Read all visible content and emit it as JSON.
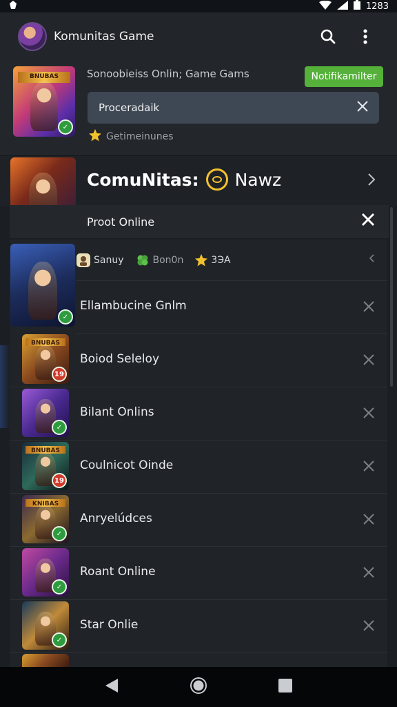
{
  "status_bar": {
    "time": "1283"
  },
  "app_bar": {
    "title": "Komunitas Game",
    "icons": [
      "search-icon",
      "more-vert-icon"
    ]
  },
  "header_card": {
    "subtitle": "Sonoobieiss Onlin; Game Gams",
    "notify_label": "Notifikamilter",
    "search_value": "Proceradaik",
    "rating_text": "Getimeinunes",
    "art_banner": "BNUBAS"
  },
  "featured": {
    "title": "ComuNitas:",
    "news_label": "Nawz",
    "dismiss_label": "Proot Online"
  },
  "meta": {
    "chips": [
      {
        "icon": "user-icon",
        "label": "Sanuy"
      },
      {
        "icon": "clover-icon",
        "label": "Bon0n"
      },
      {
        "icon": "star-icon",
        "label": "3ЭA"
      }
    ]
  },
  "list": {
    "items": [
      {
        "label": "Ellambucine Gnlm",
        "badge": ""
      },
      {
        "label": "Boiod Seleloy",
        "badge": "19",
        "banner": "BNUBAS"
      },
      {
        "label": "Bilant Onlins",
        "badge": ""
      },
      {
        "label": "Coulnicot Oinde",
        "badge": "19",
        "banner": "BNUBAS"
      },
      {
        "label": "Anryelúdces",
        "badge": "",
        "banner": "KNIBAS"
      },
      {
        "label": "Roant Online",
        "badge": ""
      },
      {
        "label": "Star Onlie",
        "badge": ""
      }
    ]
  },
  "colors": {
    "accent_green": "#55b13a",
    "badge_green": "#2e9c3e",
    "badge_red": "#d03a2a",
    "star": "#f2c12e"
  }
}
